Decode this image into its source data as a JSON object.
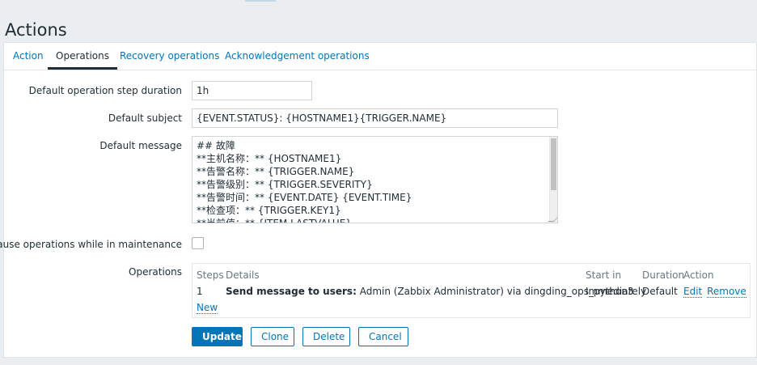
{
  "page": {
    "title": "Actions"
  },
  "tabs": [
    {
      "label": "Action"
    },
    {
      "label": "Operations"
    },
    {
      "label": "Recovery operations"
    },
    {
      "label": "Acknowledgement operations"
    }
  ],
  "form": {
    "step_duration": {
      "label": "Default operation step duration",
      "value": "1h"
    },
    "subject": {
      "label": "Default subject",
      "value": "{EVENT.STATUS}: {HOSTNAME1}{TRIGGER.NAME}"
    },
    "message": {
      "label": "Default message",
      "lines": [
        "## 故障",
        "**主机名称：** {HOSTNAME1}",
        "**告警名称：** {TRIGGER.NAME}",
        "**告警级别：** {TRIGGER.SEVERITY}",
        "**告警时间：** {EVENT.DATE} {EVENT.TIME}",
        "**检查项：** {TRIGGER.KEY1}",
        "**当前值：** {ITEM.LASTVALUE}"
      ]
    },
    "pause": {
      "label": "Pause operations while in maintenance",
      "checked": false
    }
  },
  "operations": {
    "label": "Operations",
    "headers": {
      "steps": "Steps",
      "details": "Details",
      "start_in": "Start in",
      "duration": "Duration",
      "action": "Action"
    },
    "rows": [
      {
        "steps": "1",
        "details_bold": "Send message to users:",
        "details_rest": "Admin (Zabbix Administrator) via dingding_ops_python3",
        "start_in": "Immediately",
        "duration": "Default",
        "edit": "Edit",
        "remove": "Remove"
      }
    ],
    "new_link": "New"
  },
  "buttons": {
    "update": "Update",
    "clone": "Clone",
    "delete": "Delete",
    "cancel": "Cancel"
  },
  "colors": {
    "accent": "#0275b8",
    "background": "#ebeef0",
    "panel": "#ffffff"
  }
}
